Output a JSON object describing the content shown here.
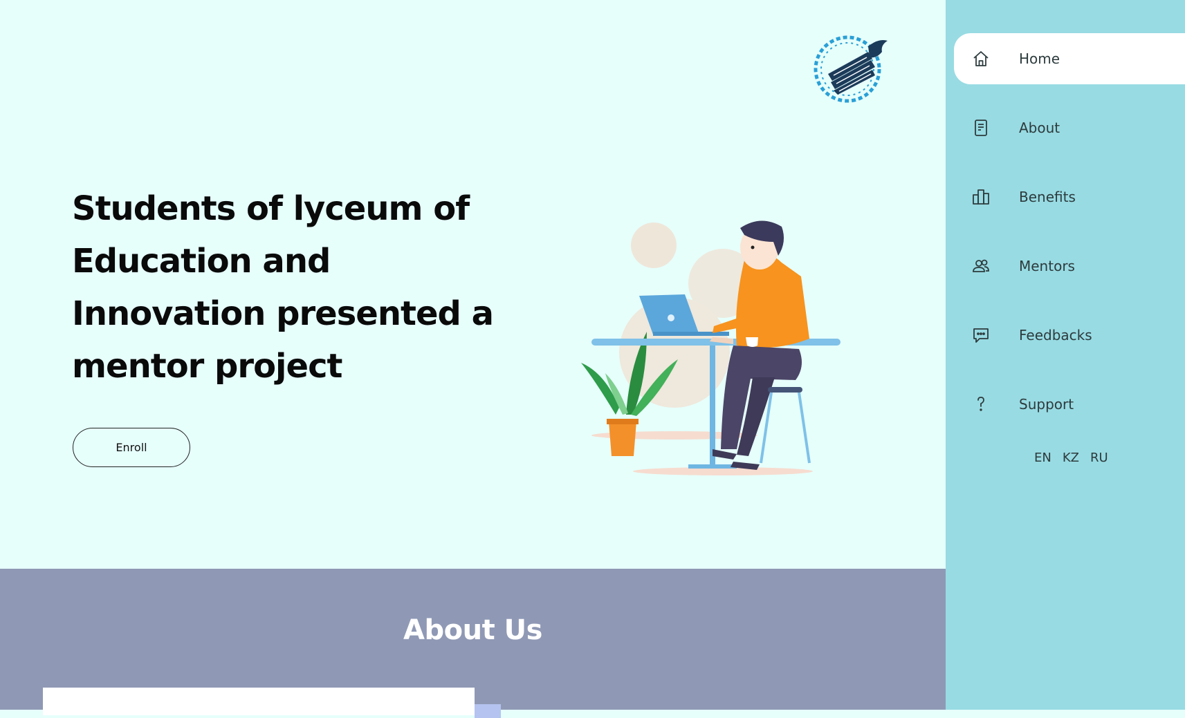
{
  "hero": {
    "title": "Students of lyceum of Education and Innovation presented a mentor project",
    "enroll_label": "Enroll"
  },
  "about": {
    "title": "About Us"
  },
  "sidebar": {
    "items": [
      {
        "label": "Home",
        "icon": "home-icon",
        "active": true
      },
      {
        "label": "About",
        "icon": "document-icon",
        "active": false
      },
      {
        "label": "Benefits",
        "icon": "buildings-icon",
        "active": false
      },
      {
        "label": "Mentors",
        "icon": "users-icon",
        "active": false
      },
      {
        "label": "Feedbacks",
        "icon": "chat-icon",
        "active": false
      },
      {
        "label": "Support",
        "icon": "question-icon",
        "active": false
      }
    ],
    "languages": [
      "EN",
      "KZ",
      "RU"
    ]
  },
  "colors": {
    "hero_bg": "#e6fffb",
    "sidebar_bg": "#98dbe3",
    "about_bg": "#8f99b5",
    "laptop": "#5ba7dc",
    "shirt": "#f7931e",
    "logo": "#1c3b5a"
  }
}
